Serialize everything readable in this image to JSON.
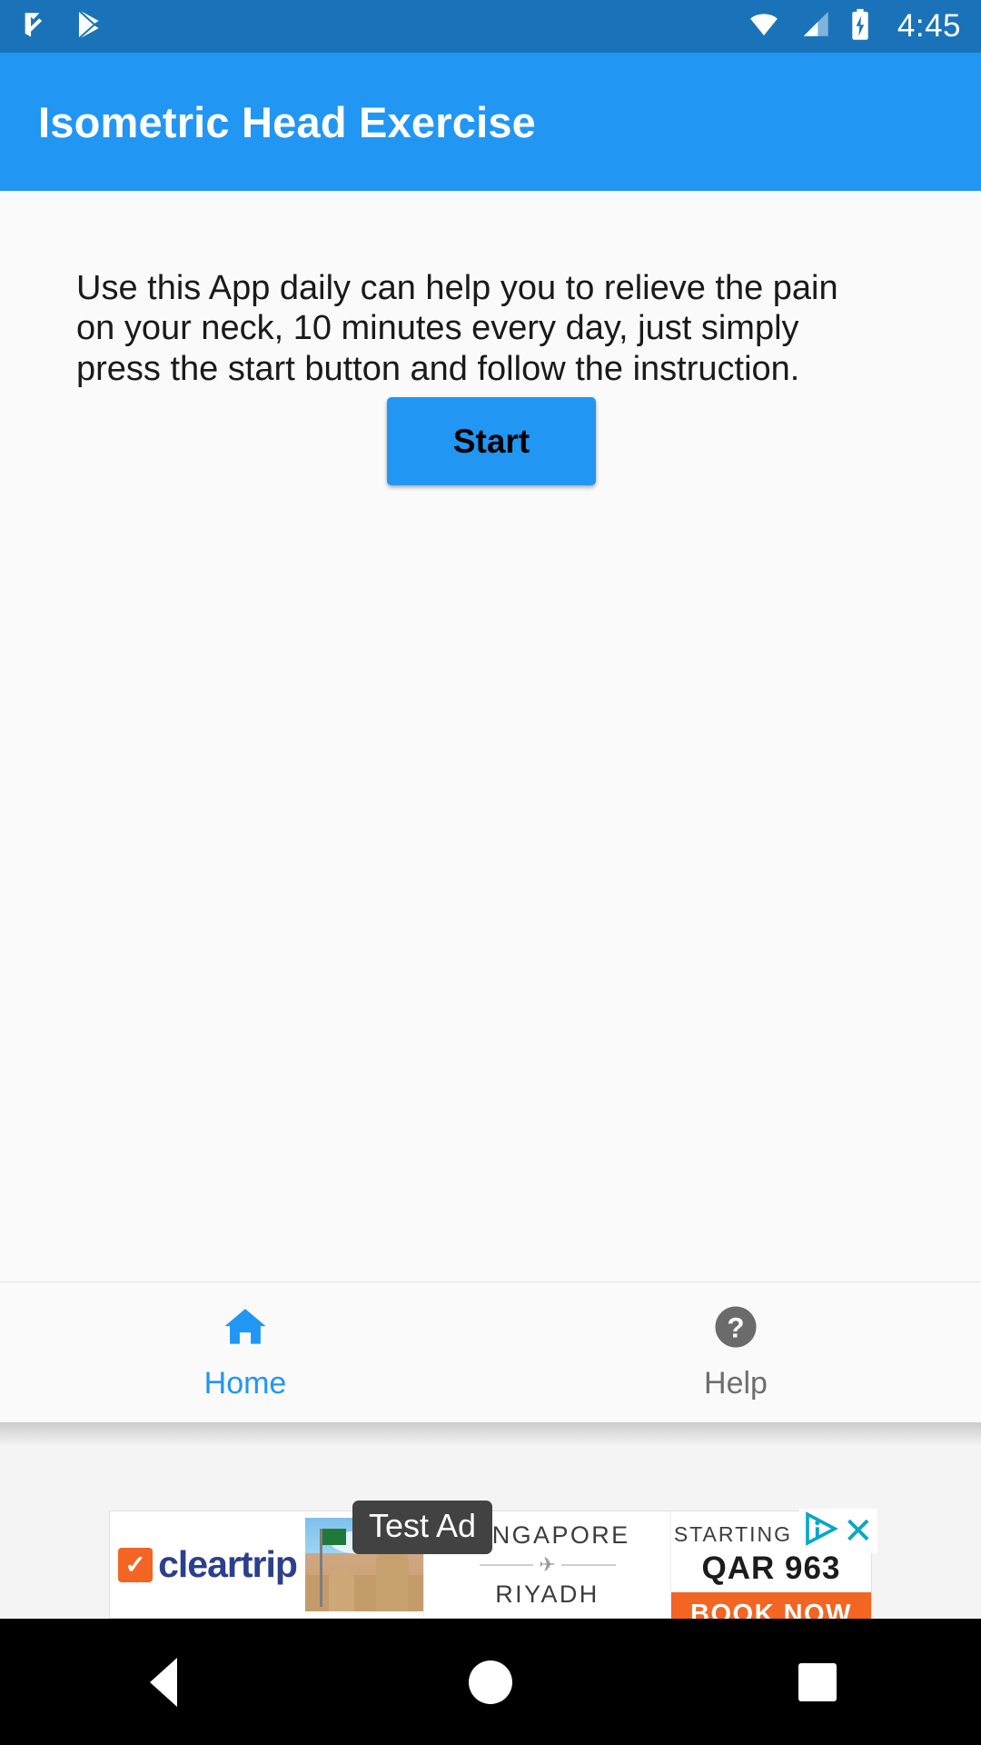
{
  "statusbar": {
    "time": "4:45",
    "icons": {
      "notification_left_1": "playstore-update-check-icon",
      "notification_left_2": "playstore-icon",
      "wifi": "wifi-icon",
      "signal": "cellular-signal-icon",
      "battery": "battery-charging-icon"
    }
  },
  "appbar": {
    "title": "Isometric Head Exercise",
    "background_color": "#2196f3"
  },
  "main": {
    "intro_text": "Use this App daily can help you to relieve the pain on your neck, 10 minutes every day, just simply press the start button and follow the instruction.",
    "start_button_label": "Start",
    "start_button_color": "#2196f3"
  },
  "bottom_nav": {
    "items": [
      {
        "label": "Home",
        "icon": "home-icon",
        "active": true,
        "color": "#2196f3"
      },
      {
        "label": "Help",
        "icon": "help-circle-icon",
        "active": false,
        "color": "#6e6e6e"
      }
    ]
  },
  "ad": {
    "badge": "Test Ad",
    "brand": "cleartrip",
    "brand_color": "#2b3f8c",
    "check_color": "#f26522",
    "origin_city": "SINGAPORE",
    "destination_city": "RIYADH",
    "starting_label": "STARTING FROM",
    "price": "QAR 963",
    "cta": "BOOK NOW",
    "cta_color": "#f26522",
    "adchoices_icon": "adchoices-icon",
    "close_icon": "close-icon",
    "close_color": "#0aa7c6"
  },
  "android_nav": {
    "back": "back-button",
    "home": "home-button",
    "recents": "recents-button"
  }
}
